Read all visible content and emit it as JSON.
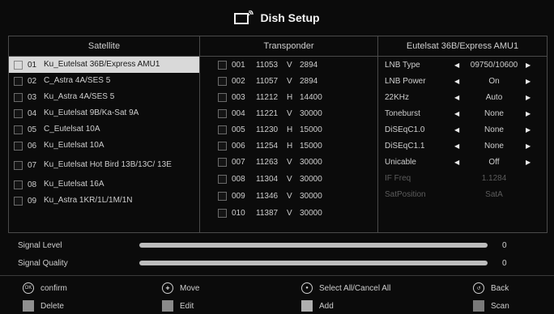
{
  "header": {
    "title": "Dish Setup",
    "icon": "satellite-tv-icon"
  },
  "satellite": {
    "heading": "Satellite",
    "items": [
      {
        "num": "01",
        "name": "Ku_Eutelsat 36B/Express AMU1",
        "selected": true
      },
      {
        "num": "02",
        "name": "C_Astra 4A/SES 5"
      },
      {
        "num": "03",
        "name": "Ku_Astra 4A/SES 5"
      },
      {
        "num": "04",
        "name": "Ku_Eutelsat 9B/Ka-Sat 9A"
      },
      {
        "num": "05",
        "name": "C_Eutelsat 10A"
      },
      {
        "num": "06",
        "name": "Ku_Eutelsat 10A"
      },
      {
        "num": "07",
        "name": "Ku_Eutelsat Hot Bird 13B/13C/ 13E"
      },
      {
        "num": "08",
        "name": "Ku_Eutelsat 16A"
      },
      {
        "num": "09",
        "name": "Ku_Astra 1KR/1L/1M/1N"
      }
    ]
  },
  "transponder": {
    "heading": "Transponder",
    "items": [
      {
        "num": "001",
        "freq": "11053",
        "pol": "V",
        "sr": "2894"
      },
      {
        "num": "002",
        "freq": "11057",
        "pol": "V",
        "sr": "2894"
      },
      {
        "num": "003",
        "freq": "11212",
        "pol": "H",
        "sr": "14400"
      },
      {
        "num": "004",
        "freq": "11221",
        "pol": "V",
        "sr": "30000"
      },
      {
        "num": "005",
        "freq": "11230",
        "pol": "H",
        "sr": "15000"
      },
      {
        "num": "006",
        "freq": "11254",
        "pol": "H",
        "sr": "15000"
      },
      {
        "num": "007",
        "freq": "11263",
        "pol": "V",
        "sr": "30000"
      },
      {
        "num": "008",
        "freq": "11304",
        "pol": "V",
        "sr": "30000"
      },
      {
        "num": "009",
        "freq": "11346",
        "pol": "V",
        "sr": "30000"
      },
      {
        "num": "010",
        "freq": "11387",
        "pol": "V",
        "sr": "30000"
      }
    ]
  },
  "settings": {
    "heading": "Eutelsat 36B/Express AMU1",
    "items": [
      {
        "label": "LNB Type",
        "value": "09750/10600",
        "enabled": true
      },
      {
        "label": "LNB Power",
        "value": "On",
        "enabled": true
      },
      {
        "label": "22KHz",
        "value": "Auto",
        "enabled": true
      },
      {
        "label": "Toneburst",
        "value": "None",
        "enabled": true
      },
      {
        "label": "DiSEqC1.0",
        "value": "None",
        "enabled": true
      },
      {
        "label": "DiSEqC1.1",
        "value": "None",
        "enabled": true
      },
      {
        "label": "Unicable",
        "value": "Off",
        "enabled": true
      },
      {
        "label": "IF Freq",
        "value": "1.1284",
        "enabled": false
      },
      {
        "label": "SatPosition",
        "value": "SatA",
        "enabled": false
      }
    ]
  },
  "signal": {
    "level_label": "Signal Level",
    "level_value": "0",
    "quality_label": "Signal Quality",
    "quality_value": "0"
  },
  "legend": {
    "confirm": "confirm",
    "move": "Move",
    "select_all": "Select All/Cancel All",
    "back": "Back",
    "delete": "Delete",
    "edit": "Edit",
    "add": "Add",
    "scan": "Scan"
  }
}
